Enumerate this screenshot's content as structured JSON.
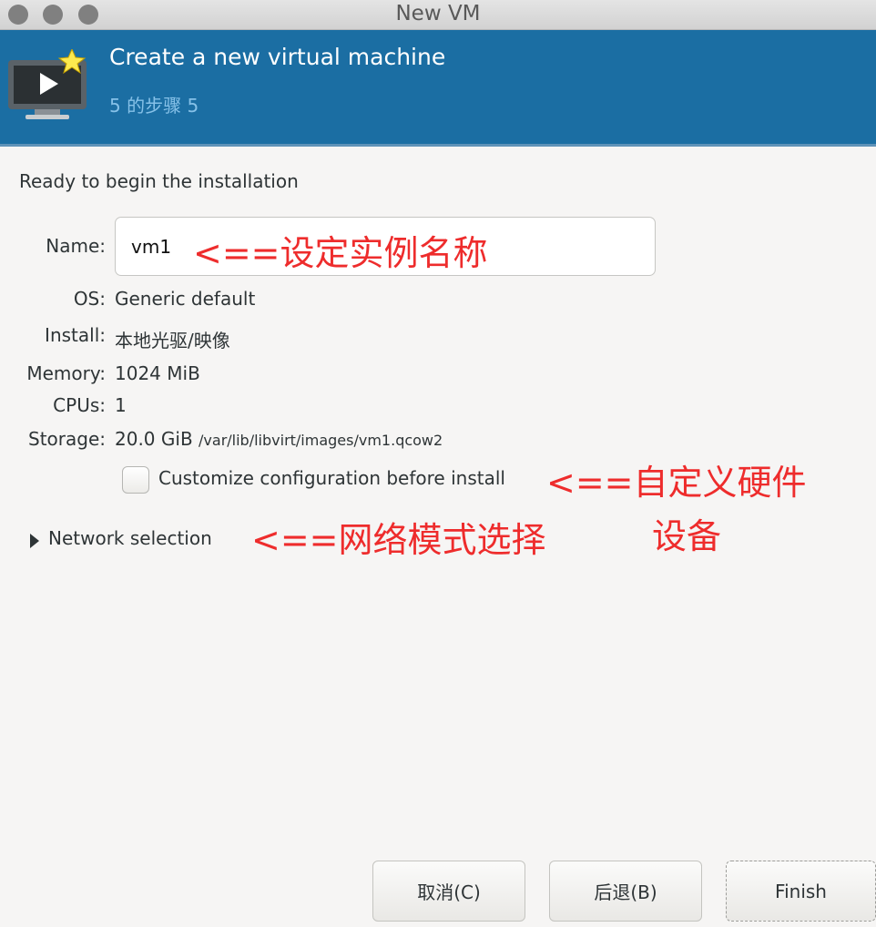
{
  "window": {
    "title": "New VM"
  },
  "header": {
    "title": "Create a new virtual machine",
    "step": "5 的步骤 5",
    "icon": "monitor-star-icon"
  },
  "main": {
    "heading": "Ready to begin the installation",
    "name": {
      "label": "Name:",
      "value": "vm1"
    },
    "os": {
      "label": "OS:",
      "value": "Generic default"
    },
    "install": {
      "label": "Install:",
      "value": "本地光驱/映像"
    },
    "memory": {
      "label": "Memory:",
      "value": "1024 MiB"
    },
    "cpus": {
      "label": "CPUs:",
      "value": "1"
    },
    "storage": {
      "label": "Storage:",
      "size": "20.0 GiB",
      "path": "/var/lib/libvirt/images/vm1.qcow2"
    },
    "customize": {
      "label": "Customize configuration before install",
      "checked": false
    },
    "network": {
      "label": "Network selection",
      "expanded": false
    }
  },
  "annotations": {
    "name_note": "<==设定实例名称",
    "customize_note": "<==自定义硬件",
    "customize_note_line2": "设备",
    "network_note": "<==网络模式选择",
    "color": "#ee2c2c"
  },
  "buttons": {
    "cancel": "取消(C)",
    "back": "后退(B)",
    "finish": "Finish"
  }
}
